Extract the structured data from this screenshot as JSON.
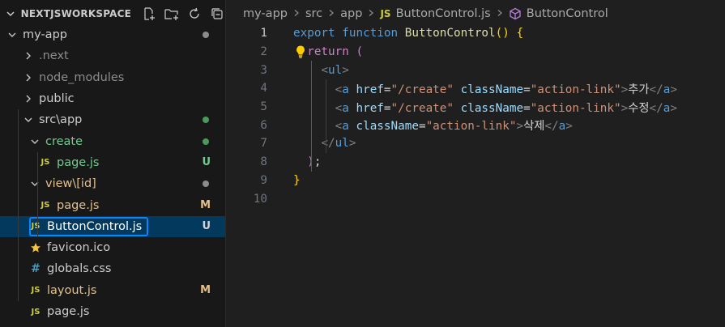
{
  "explorer": {
    "workspace_title": "NEXTJSWORKSPACE",
    "actions": [
      {
        "name": "new-file-icon"
      },
      {
        "name": "new-folder-icon"
      },
      {
        "name": "refresh-icon"
      },
      {
        "name": "collapse-all-icon"
      }
    ],
    "tree": [
      {
        "label": "my-app",
        "type": "folder",
        "open": true,
        "indent": 0,
        "color": "#cccccc",
        "decoration": "dot",
        "deco_color": "#8b8b8b"
      },
      {
        "label": ".next",
        "type": "folder",
        "open": false,
        "indent": 1,
        "color": "#8c8c8c"
      },
      {
        "label": "node_modules",
        "type": "folder",
        "open": false,
        "indent": 1,
        "color": "#8c8c8c"
      },
      {
        "label": "public",
        "type": "folder",
        "open": false,
        "indent": 1,
        "color": "#cccccc"
      },
      {
        "label": "src\\app",
        "type": "folder",
        "open": true,
        "indent": 1,
        "color": "#cccccc",
        "decoration": "dot",
        "deco_color": "#4a9a5b"
      },
      {
        "label": "create",
        "type": "folder",
        "open": true,
        "indent": 2,
        "color": "#73c991",
        "decoration": "dot",
        "deco_color": "#4a9a5b"
      },
      {
        "label": "page.js",
        "type": "js",
        "indent": 3,
        "color": "#73c991",
        "decoration": "U",
        "deco_color": "#73c991"
      },
      {
        "label": "view\\[id]",
        "type": "folder",
        "open": true,
        "indent": 2,
        "color": "#e2c08d",
        "decoration": "dot",
        "deco_color": "#8b8b8b"
      },
      {
        "label": "page.js",
        "type": "js",
        "indent": 3,
        "color": "#e2c08d",
        "decoration": "M",
        "deco_color": "#e2c08d"
      },
      {
        "label": "ButtonControl.js",
        "type": "js",
        "indent": 2,
        "color": "#ffffff",
        "decoration": "U",
        "deco_color": "#d4d4d4",
        "selected": true
      },
      {
        "label": "favicon.ico",
        "type": "star",
        "indent": 2,
        "color": "#cccccc"
      },
      {
        "label": "globals.css",
        "type": "css",
        "indent": 2,
        "color": "#cccccc"
      },
      {
        "label": "layout.js",
        "type": "js",
        "indent": 2,
        "color": "#e2c08d",
        "decoration": "M",
        "deco_color": "#e2c08d"
      },
      {
        "label": "page.js",
        "type": "js",
        "indent": 2,
        "color": "#cccccc"
      }
    ]
  },
  "breadcrumb": {
    "items": [
      "my-app",
      "src",
      "app",
      "ButtonControl.js",
      "ButtonControl"
    ],
    "file_badge": "JS"
  },
  "code": {
    "active_line": 1,
    "lines": [
      {
        "n": "1",
        "tokens": [
          [
            "kw",
            "export"
          ],
          [
            "txt",
            " "
          ],
          [
            "kw",
            "function"
          ],
          [
            "txt",
            " "
          ],
          [
            "fn",
            "ButtonControl"
          ],
          [
            "br1",
            "()"
          ],
          [
            "txt",
            " "
          ],
          [
            "br1",
            "{"
          ]
        ]
      },
      {
        "n": "2",
        "bulb": true,
        "tokens": [
          [
            "txt",
            "  "
          ],
          [
            "kw2",
            "return"
          ],
          [
            "txt",
            " "
          ],
          [
            "br2",
            "("
          ]
        ]
      },
      {
        "n": "3",
        "tokens": [
          [
            "txt",
            "    "
          ],
          [
            "angle",
            "<"
          ],
          [
            "tag",
            "ul"
          ],
          [
            "angle",
            ">"
          ]
        ]
      },
      {
        "n": "4",
        "tokens": [
          [
            "txt",
            "      "
          ],
          [
            "angle",
            "<"
          ],
          [
            "tag",
            "a"
          ],
          [
            "txt",
            " "
          ],
          [
            "attr",
            "href"
          ],
          [
            "txt",
            "="
          ],
          [
            "str",
            "\"/create\""
          ],
          [
            "txt",
            " "
          ],
          [
            "attr",
            "className"
          ],
          [
            "txt",
            "="
          ],
          [
            "str",
            "\"action-link\""
          ],
          [
            "angle",
            ">"
          ],
          [
            "txt",
            "추가"
          ],
          [
            "angle",
            "</"
          ],
          [
            "tag",
            "a"
          ],
          [
            "angle",
            ">"
          ]
        ]
      },
      {
        "n": "5",
        "tokens": [
          [
            "txt",
            "      "
          ],
          [
            "angle",
            "<"
          ],
          [
            "tag",
            "a"
          ],
          [
            "txt",
            " "
          ],
          [
            "attr",
            "href"
          ],
          [
            "txt",
            "="
          ],
          [
            "str",
            "\"/create\""
          ],
          [
            "txt",
            " "
          ],
          [
            "attr",
            "className"
          ],
          [
            "txt",
            "="
          ],
          [
            "str",
            "\"action-link\""
          ],
          [
            "angle",
            ">"
          ],
          [
            "txt",
            "수정"
          ],
          [
            "angle",
            "</"
          ],
          [
            "tag",
            "a"
          ],
          [
            "angle",
            ">"
          ]
        ]
      },
      {
        "n": "6",
        "tokens": [
          [
            "txt",
            "      "
          ],
          [
            "angle",
            "<"
          ],
          [
            "tag",
            "a"
          ],
          [
            "txt",
            " "
          ],
          [
            "attr",
            "className"
          ],
          [
            "txt",
            "="
          ],
          [
            "str",
            "\"action-link\""
          ],
          [
            "angle",
            ">"
          ],
          [
            "txt",
            "삭제"
          ],
          [
            "angle",
            "</"
          ],
          [
            "tag",
            "a"
          ],
          [
            "angle",
            ">"
          ]
        ]
      },
      {
        "n": "7",
        "tokens": [
          [
            "txt",
            "    "
          ],
          [
            "angle",
            "</"
          ],
          [
            "tag",
            "ul"
          ],
          [
            "angle",
            ">"
          ]
        ]
      },
      {
        "n": "8",
        "tokens": [
          [
            "txt",
            "  "
          ],
          [
            "br2",
            ")"
          ],
          [
            "txt",
            ";"
          ]
        ]
      },
      {
        "n": "9",
        "tokens": [
          [
            "br1",
            "}"
          ]
        ]
      },
      {
        "n": "10",
        "tokens": []
      }
    ]
  }
}
